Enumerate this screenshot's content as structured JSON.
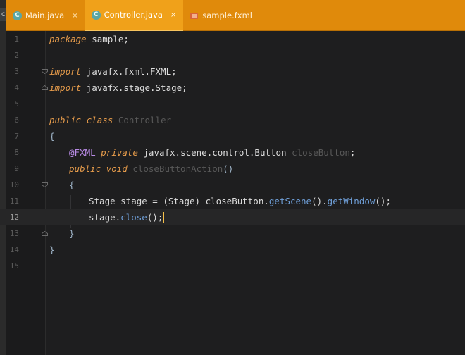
{
  "window": {
    "left_strip_glyph": "c"
  },
  "tabs": [
    {
      "label": "Main.java",
      "icon": "java-class-icon",
      "icon_letter": "C",
      "active": false
    },
    {
      "label": "Controller.java",
      "icon": "java-class-icon",
      "icon_letter": "C",
      "active": true
    },
    {
      "label": "sample.fxml",
      "icon": "fxml-file-icon",
      "active": false
    }
  ],
  "tab_close_glyph": "×",
  "editor": {
    "current_line": 12,
    "line_numbers": [
      "1",
      "2",
      "3",
      "4",
      "5",
      "6",
      "7",
      "8",
      "9",
      "10",
      "11",
      "12",
      "13",
      "14",
      "15"
    ],
    "lines": {
      "l1": {
        "kw": "package",
        "rest": " sample;"
      },
      "l3": {
        "kw": "import",
        "rest": " javafx.fxml.FXML;"
      },
      "l4": {
        "kw": "import",
        "rest": " javafx.stage.Stage;"
      },
      "l6": {
        "kw1": "public",
        "kw2": "class",
        "name": "Controller"
      },
      "l7": {
        "text": "{"
      },
      "l8": {
        "annot": "@FXML",
        "kw": "private",
        "type": "javafx.scene.control.Button",
        "name": "closeButton",
        "end": ";"
      },
      "l9": {
        "kw1": "public",
        "kw2": "void",
        "name": "closeButtonAction",
        "parens": "()"
      },
      "l10": {
        "text": "{"
      },
      "l11": {
        "t1": "Stage stage = (Stage) closeButton.",
        "m1": "getScene",
        "t2": "().",
        "m2": "getWindow",
        "t3": "();"
      },
      "l12": {
        "t1": "stage.",
        "m1": "close",
        "t2": "();"
      },
      "l13": {
        "text": "}"
      },
      "l14": {
        "text": "}"
      }
    }
  },
  "colors": {
    "tabbar": "#e08a0b",
    "tab_active": "#f0a11a",
    "editor_bg": "#1e1e1f",
    "keyword": "#e59b4b",
    "annotation": "#b98be6",
    "method": "#6f9fd8",
    "caret": "#f5c04a"
  }
}
